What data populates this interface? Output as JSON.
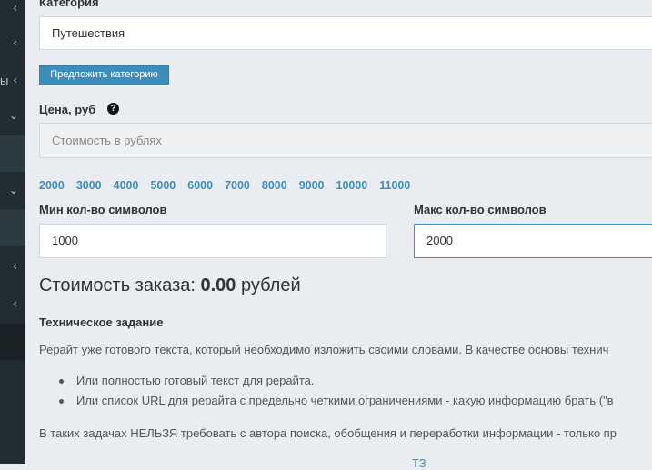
{
  "sidebar": {
    "partial_label": "ы",
    "chevron_left": "‹",
    "chevron_down": "⌄"
  },
  "form": {
    "category_label": "Категория",
    "category_value": "Путешествия",
    "suggest_category_button": "Предложить категорию",
    "price_label": "Цена, руб",
    "price_placeholder": "Стоимость в рублях",
    "price_presets": [
      "2000",
      "3000",
      "4000",
      "5000",
      "6000",
      "7000",
      "8000",
      "9000",
      "10000",
      "11000"
    ],
    "min_chars_label": "Мин кол-во символов",
    "min_chars_value": "1000",
    "max_chars_label": "Макс кол-во символов",
    "max_chars_value": "2000",
    "cost_prefix": "Стоимость заказа:",
    "cost_value": "0.00",
    "cost_suffix": "рублей"
  },
  "spec": {
    "title": "Техническое задание",
    "intro": "Рерайт уже готового текста, который необходимо изложить своими словами. В качестве основы технич",
    "bullets": [
      "Или полностью готовый текст для рерайта.",
      "Или список URL для рерайта с предельно четкими ограничениями - какую информацию брать (\"в"
    ],
    "note": "В таких задачах НЕЛЬЗЯ требовать с автора поиска, обобщения и переработки информации - только пр",
    "cut_fragment": "ТЗ"
  }
}
